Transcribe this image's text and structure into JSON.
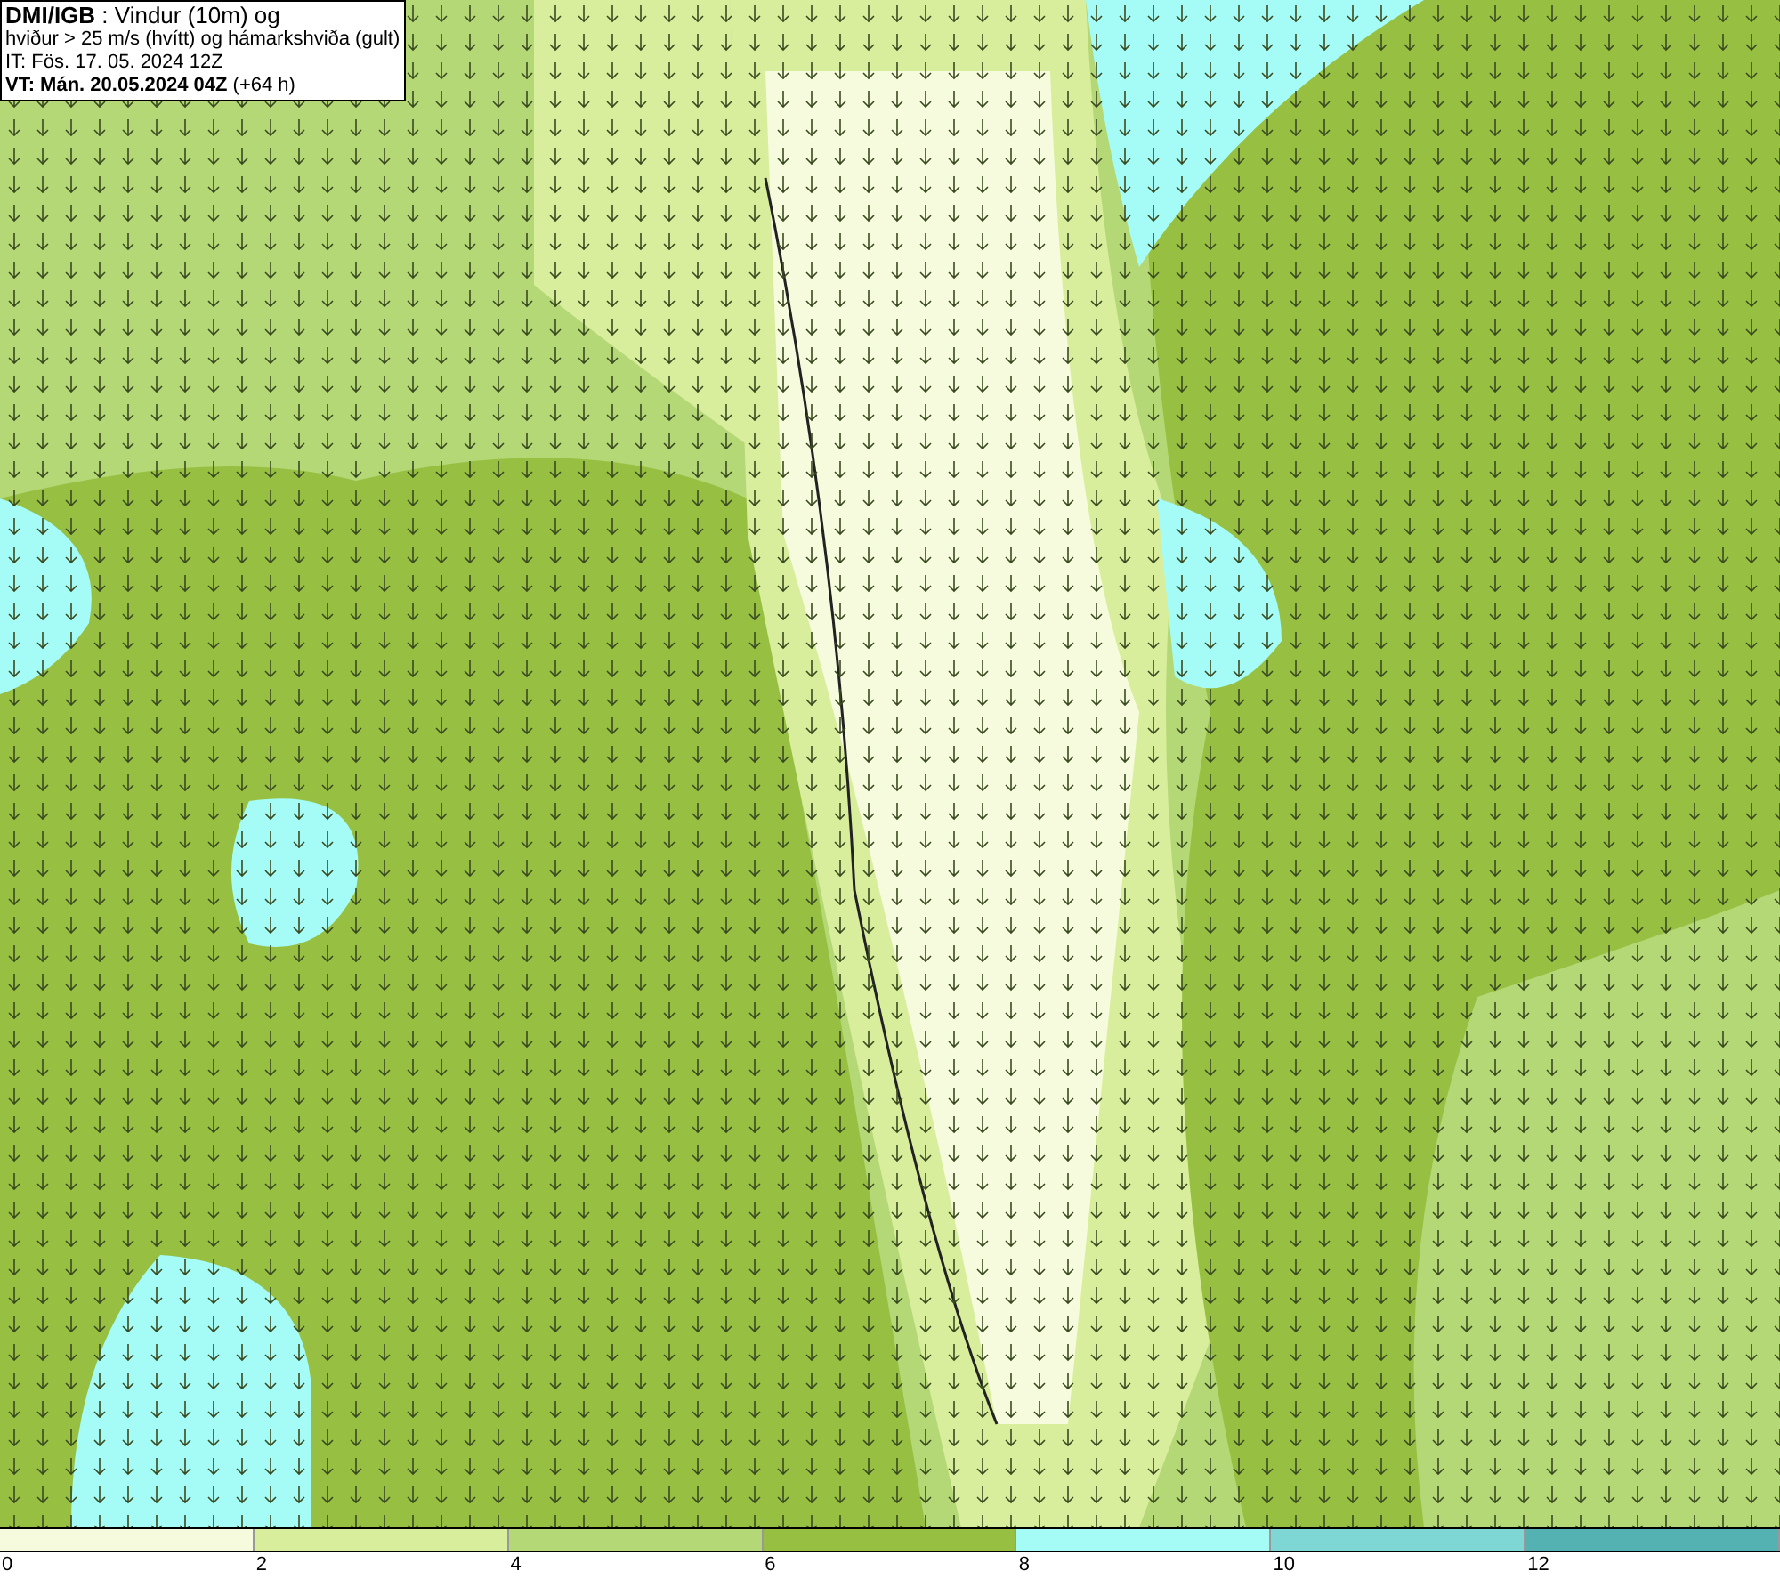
{
  "title_box": {
    "lines": [
      "**DMI/IGB** : Vindur (10m) og",
      "hviður > 25 m/s (hvítt) og hámarkshviða (gult)",
      "IT: Fös. 17. 05. 2024 12Z",
      "**VT: Mán. 20.05.2024 04Z** (+64 h)"
    ]
  },
  "legend": {
    "bins": [
      {
        "color": "#f5fbdc",
        "label": "0"
      },
      {
        "color": "#d8ee9c",
        "label": "2"
      },
      {
        "color": "#b5d877",
        "label": "4"
      },
      {
        "color": "#97c043",
        "label": "6"
      },
      {
        "color": "#a5fcf7",
        "label": "8"
      },
      {
        "color": "#7ed6d5",
        "label": "10"
      },
      {
        "color": "#55b2b3",
        "label": "12"
      }
    ]
  }
}
